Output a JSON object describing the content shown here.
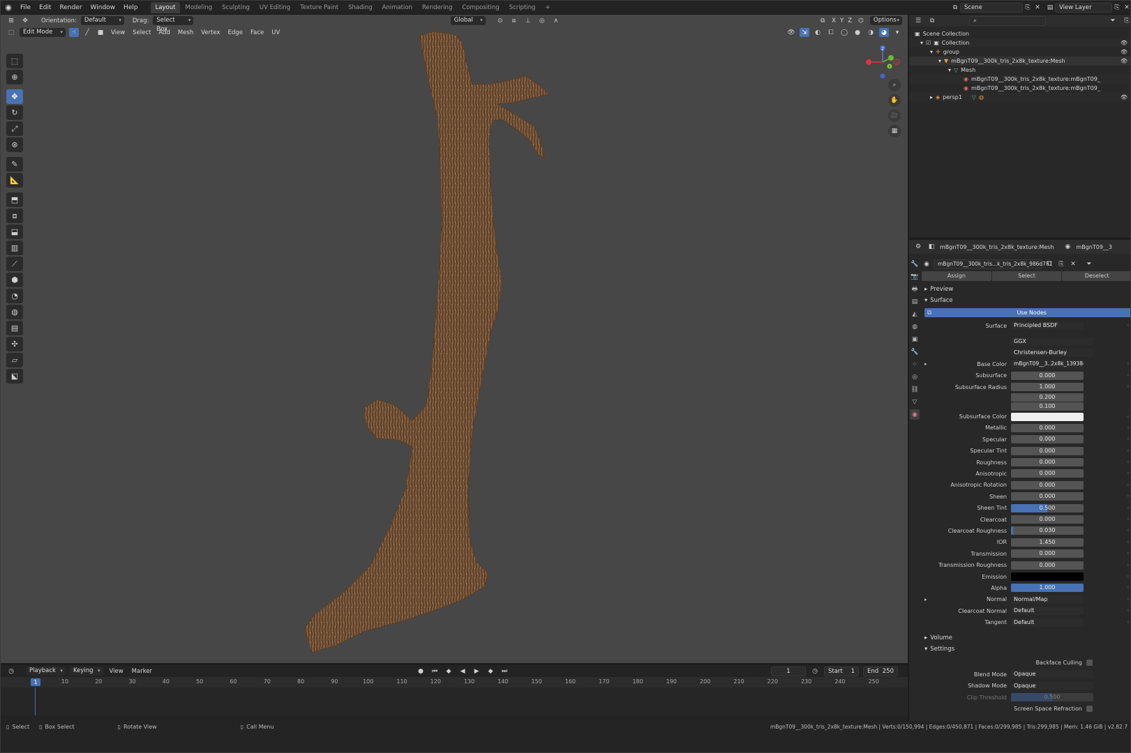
{
  "topbar": {
    "menus": [
      "File",
      "Edit",
      "Render",
      "Window",
      "Help"
    ],
    "workspaces": [
      "Layout",
      "Modeling",
      "Sculpting",
      "UV Editing",
      "Texture Paint",
      "Shading",
      "Animation",
      "Rendering",
      "Compositing",
      "Scripting"
    ],
    "active_workspace": "Layout",
    "add_workspace": "+",
    "scene": "Scene",
    "view_layer": "View Layer"
  },
  "viewport_header": {
    "orientation_label": "Orientation:",
    "orientation_value": "Default",
    "drag_label": "Drag:",
    "drag_value": "Select Box",
    "transform_orientation": "Global",
    "options": "Options",
    "mode": "Edit Mode",
    "menus": [
      "View",
      "Select",
      "Add",
      "Mesh",
      "Vertex",
      "Edge",
      "Face",
      "UV"
    ],
    "axis_x": "X",
    "axis_y": "Y",
    "axis_z": "Z"
  },
  "gizmo": {
    "z": "Z",
    "y": "Y",
    "x": "X"
  },
  "outliner": {
    "rows": [
      {
        "label": "Scene Collection",
        "indent": 0
      },
      {
        "label": "Collection",
        "indent": 1
      },
      {
        "label": "group",
        "indent": 2
      },
      {
        "label": "mBgnT09__300k_tris_2x8k_texture:Mesh",
        "indent": 3
      },
      {
        "label": "Mesh",
        "indent": 4
      },
      {
        "label": "mBgnT09__300k_tris_2x8k_texture:mBgnT09_",
        "indent": 5
      },
      {
        "label": "mBgnT09__300k_tris_2x8k_texture:mBgnT09_",
        "indent": 5
      },
      {
        "label": "persp1",
        "indent": 2
      }
    ]
  },
  "properties": {
    "object_name": "mBgnT09__300k_tris_2x8k_texture:Mesh",
    "object_name_short": "mBgnT09__3",
    "material_name": "mBgnT09__300k_tris...k_tris_2x8k_986d781",
    "assign": "Assign",
    "select": "Select",
    "deselect": "Deselect",
    "preview": "Preview",
    "surface_section": "Surface",
    "use_nodes": "Use Nodes",
    "surface_label": "Surface",
    "surface_value": "Principled BSDF",
    "distribution": "GGX",
    "subsurface_method": "Christensen-Burley",
    "base_color_label": "Base Color",
    "base_color_value": "mBgnT09__3..2x8k_13938e2",
    "rows": [
      {
        "label": "Subsurface",
        "value": "0.000",
        "fill": 0
      },
      {
        "label": "Subsurface Radius",
        "value": "1.000",
        "fill": 0
      },
      {
        "label": "",
        "value": "0.200",
        "fill": 0
      },
      {
        "label": "",
        "value": "0.100",
        "fill": 0
      }
    ],
    "subsurface_color_label": "Subsurface Color",
    "params": [
      {
        "label": "Metallic",
        "value": "0.000",
        "fill": 0
      },
      {
        "label": "Specular",
        "value": "0.000",
        "fill": 0
      },
      {
        "label": "Specular Tint",
        "value": "0.000",
        "fill": 0
      },
      {
        "label": "Roughness",
        "value": "0.000",
        "fill": 0
      },
      {
        "label": "Anisotropic",
        "value": "0.000",
        "fill": 0
      },
      {
        "label": "Anisotropic Rotation",
        "value": "0.000",
        "fill": 0
      },
      {
        "label": "Sheen",
        "value": "0.000",
        "fill": 0
      },
      {
        "label": "Sheen Tint",
        "value": "0.500",
        "fill": 0.5
      },
      {
        "label": "Clearcoat",
        "value": "0.000",
        "fill": 0
      },
      {
        "label": "Clearcoat Roughness",
        "value": "0.030",
        "fill": 0.03
      },
      {
        "label": "IOR",
        "value": "1.450",
        "fill": 0
      },
      {
        "label": "Transmission",
        "value": "0.000",
        "fill": 0
      },
      {
        "label": "Transmission Roughness",
        "value": "0.000",
        "fill": 0
      }
    ],
    "emission_label": "Emission",
    "alpha_label": "Alpha",
    "alpha_value": "1.000",
    "alpha_fill": 1.0,
    "normal_label": "Normal",
    "normal_value": "Normal/Map",
    "clearcoat_normal_label": "Clearcoat Normal",
    "clearcoat_normal_value": "Default",
    "tangent_label": "Tangent",
    "tangent_value": "Default",
    "volume": "Volume",
    "settings": "Settings",
    "backface_culling": "Backface Culling",
    "blend_mode_label": "Blend Mode",
    "blend_mode_value": "Opaque",
    "shadow_mode_label": "Shadow Mode",
    "shadow_mode_value": "Opaque",
    "clip_threshold_label": "Clip Threshold",
    "clip_threshold_value": "0.500",
    "screen_space_refraction": "Screen Space Refraction"
  },
  "timeline": {
    "menus": [
      "Playback",
      "Keying",
      "View",
      "Marker"
    ],
    "current_frame": "1",
    "start_label": "Start",
    "start_value": "1",
    "end_label": "End",
    "end_value": "250",
    "ticks": [
      "10",
      "20",
      "30",
      "40",
      "50",
      "60",
      "70",
      "80",
      "90",
      "100",
      "110",
      "120",
      "130",
      "140",
      "150",
      "160",
      "170",
      "180",
      "190",
      "200",
      "210",
      "220",
      "230",
      "240",
      "250"
    ],
    "playhead": "1"
  },
  "statusbar": {
    "select": "Select",
    "box_select": "Box Select",
    "rotate_view": "Rotate View",
    "call_menu": "Call Menu",
    "stats": "mBgnT09__300k_tris_2x8k_texture:Mesh | Verts:0/150,994 | Edges:0/450,871 | Faces:0/299,985 | Tris:299,985 | Mem: 1.46 GiB | v2.82.7"
  },
  "colors": {
    "accent": "#4772b3",
    "viewport_bg": "#474747",
    "bark": "#7a5a3e"
  }
}
